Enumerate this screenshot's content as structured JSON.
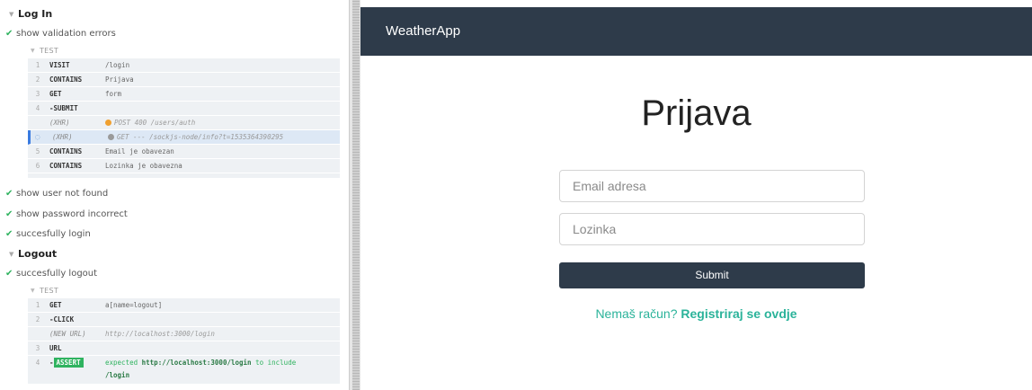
{
  "reporter": {
    "suites": [
      {
        "title": "Log In",
        "tests": [
          {
            "title": "show validation errors",
            "label": "TEST",
            "commands": [
              {
                "num": "1",
                "name": "VISIT",
                "message": "/login"
              },
              {
                "num": "2",
                "name": "CONTAINS",
                "message": "Prijava"
              },
              {
                "num": "3",
                "name": "GET",
                "message": "form"
              },
              {
                "num": "4",
                "name": "-SUBMIT",
                "message": ""
              },
              {
                "num": "",
                "name": "(XHR)",
                "message": "POST 400 /users/auth",
                "dot_color": "#f0a030"
              },
              {
                "num": "",
                "name": "(XHR)",
                "message": "GET --- /sockjs-node/info?t=1535364390295",
                "dot_color": "#9a9a9a"
              },
              {
                "num": "5",
                "name": "CONTAINS",
                "message": "Email je obavezan"
              },
              {
                "num": "6",
                "name": "CONTAINS",
                "message": "Lozinka je obavezna"
              }
            ]
          },
          {
            "title": "show user not found"
          },
          {
            "title": "show password incorrect"
          },
          {
            "title": "succesfully login"
          }
        ]
      },
      {
        "title": "Logout",
        "tests": [
          {
            "title": "succesfully logout",
            "label": "TEST",
            "commands": [
              {
                "num": "1",
                "name": "GET",
                "message": "a[name=logout]"
              },
              {
                "num": "2",
                "name": "-CLICK",
                "message": ""
              },
              {
                "num": "",
                "name": "(NEW URL)",
                "message": "http://localhost:3000/login"
              },
              {
                "num": "3",
                "name": "URL",
                "message": ""
              },
              {
                "num": "4",
                "name": "-ASSERT",
                "badge": "ASSERT",
                "message_pre": "expected ",
                "message_url": "http://localhost:3000/login",
                "message_mid": " to include",
                "message_tail": "/login"
              }
            ]
          }
        ]
      }
    ],
    "colors": {
      "pass": "#2fb35f",
      "active": "#3a7be0"
    }
  },
  "app": {
    "brand": "WeatherApp",
    "title": "Prijava",
    "email_placeholder": "Email adresa",
    "password_placeholder": "Lozinka",
    "submit_label": "Submit",
    "register_prompt": "Nemaš račun?",
    "register_link": "Registriraj se ovdje",
    "colors": {
      "navbar": "#2e3b4a",
      "link": "#2bb39a"
    }
  }
}
